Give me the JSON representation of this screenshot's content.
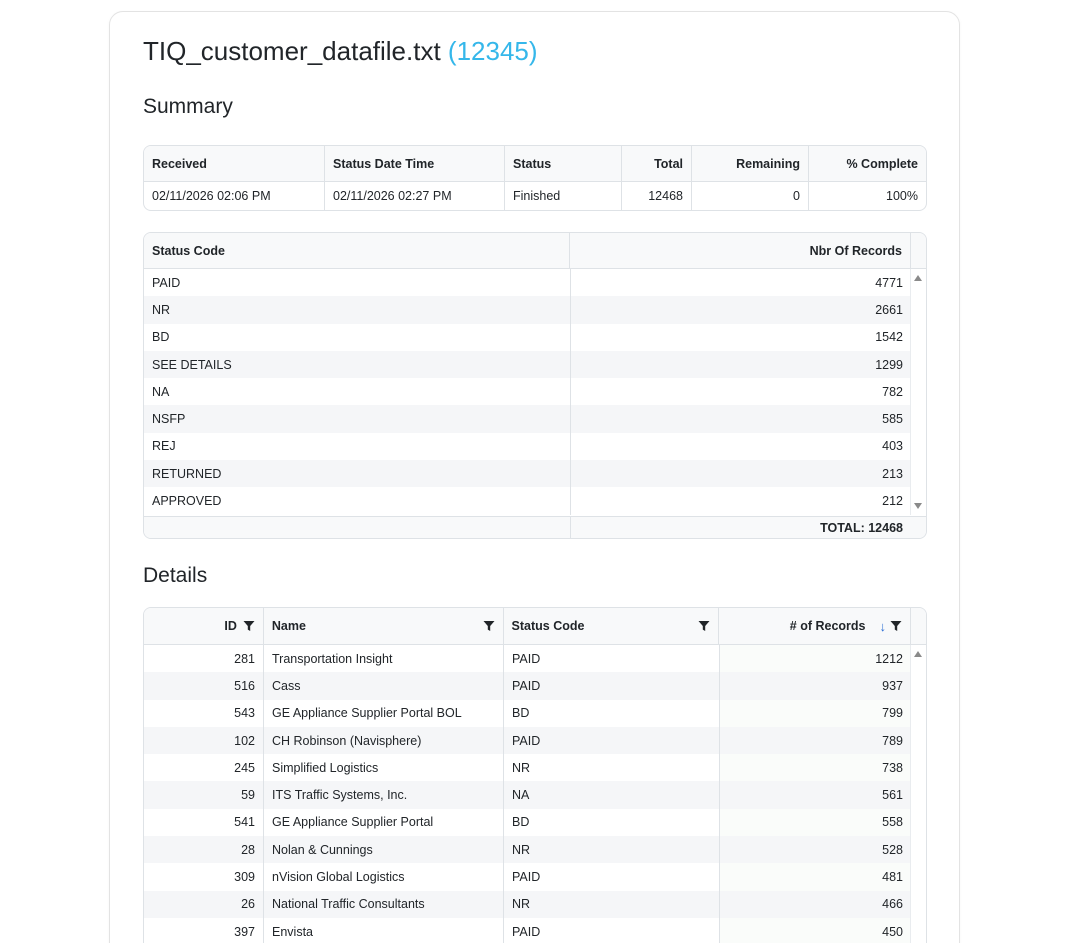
{
  "header": {
    "file_name": "TIQ_customer_datafile.txt",
    "file_id": "(12345)"
  },
  "summary": {
    "heading": "Summary",
    "columns": {
      "received": "Received",
      "status_date_time": "Status Date Time",
      "status": "Status",
      "total": "Total",
      "remaining": "Remaining",
      "pct_complete": "% Complete"
    },
    "row": {
      "received": "02/11/2026 02:06 PM",
      "status_date_time": "02/11/2026 02:27 PM",
      "status": "Finished",
      "total": "12468",
      "remaining": "0",
      "pct_complete": "100%"
    }
  },
  "status_codes": {
    "columns": {
      "code": "Status Code",
      "records": "Nbr Of Records"
    },
    "rows": [
      {
        "code": "PAID",
        "records": "4771"
      },
      {
        "code": "NR",
        "records": "2661"
      },
      {
        "code": "BD",
        "records": "1542"
      },
      {
        "code": "SEE DETAILS",
        "records": "1299"
      },
      {
        "code": "NA",
        "records": "782"
      },
      {
        "code": "NSFP",
        "records": "585"
      },
      {
        "code": "REJ",
        "records": "403"
      },
      {
        "code": "RETURNED",
        "records": "213"
      },
      {
        "code": "APPROVED",
        "records": "212"
      }
    ],
    "total_label": "TOTAL: 12468"
  },
  "details": {
    "heading": "Details",
    "columns": {
      "id": "ID",
      "name": "Name",
      "status_code": "Status Code",
      "records": "# of Records"
    },
    "rows": [
      {
        "id": "281",
        "name": "Transportation Insight",
        "status_code": "PAID",
        "records": "1212"
      },
      {
        "id": "516",
        "name": "Cass",
        "status_code": "PAID",
        "records": "937"
      },
      {
        "id": "543",
        "name": "GE Appliance Supplier Portal BOL",
        "status_code": "BD",
        "records": "799"
      },
      {
        "id": "102",
        "name": "CH Robinson (Navisphere)",
        "status_code": "PAID",
        "records": "789"
      },
      {
        "id": "245",
        "name": "Simplified Logistics",
        "status_code": "NR",
        "records": "738"
      },
      {
        "id": "59",
        "name": "ITS Traffic Systems, Inc.",
        "status_code": "NA",
        "records": "561"
      },
      {
        "id": "541",
        "name": "GE Appliance Supplier Portal",
        "status_code": "BD",
        "records": "558"
      },
      {
        "id": "28",
        "name": "Nolan & Cunnings",
        "status_code": "NR",
        "records": "528"
      },
      {
        "id": "309",
        "name": "nVision Global Logistics",
        "status_code": "PAID",
        "records": "481"
      },
      {
        "id": "26",
        "name": "National Traffic Consultants",
        "status_code": "NR",
        "records": "466"
      },
      {
        "id": "397",
        "name": "Envista",
        "status_code": "PAID",
        "records": "450"
      }
    ]
  },
  "colors": {
    "accent": "#35b7ea",
    "sort_arrow": "#2c6ed5",
    "border": "#dee2e6",
    "header_bg": "#f8f9fa",
    "stripe_bg": "#f5f6f8"
  },
  "icons": {
    "filter": "filter-icon",
    "sort_desc": "sort-down-icon",
    "scroll_up": "scroll-up-arrow-icon",
    "scroll_down": "scroll-down-arrow-icon"
  }
}
